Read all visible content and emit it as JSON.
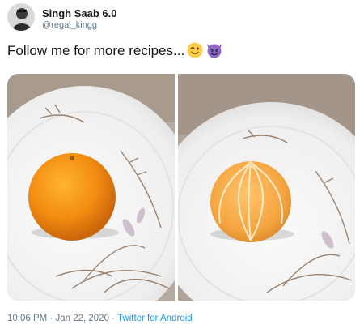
{
  "author": {
    "display_name": "Singh Saab 6.0",
    "handle": "@regal_kingg"
  },
  "tweet": {
    "text": "Follow me for more recipes...",
    "emojis": [
      "winking-face-emoji",
      "smiling-face-with-horns-emoji"
    ]
  },
  "media": [
    {
      "name": "whole-mandarin-on-plate-photo"
    },
    {
      "name": "peeled-mandarin-on-plate-photo"
    }
  ],
  "meta": {
    "time": "10:06 PM",
    "separator1": " · ",
    "date": "Jan 22, 2020",
    "separator2": " · ",
    "source": "Twitter for Android"
  },
  "colors": {
    "source_link": "#1b95e0",
    "secondary_text": "#657786",
    "text": "#14171a"
  }
}
